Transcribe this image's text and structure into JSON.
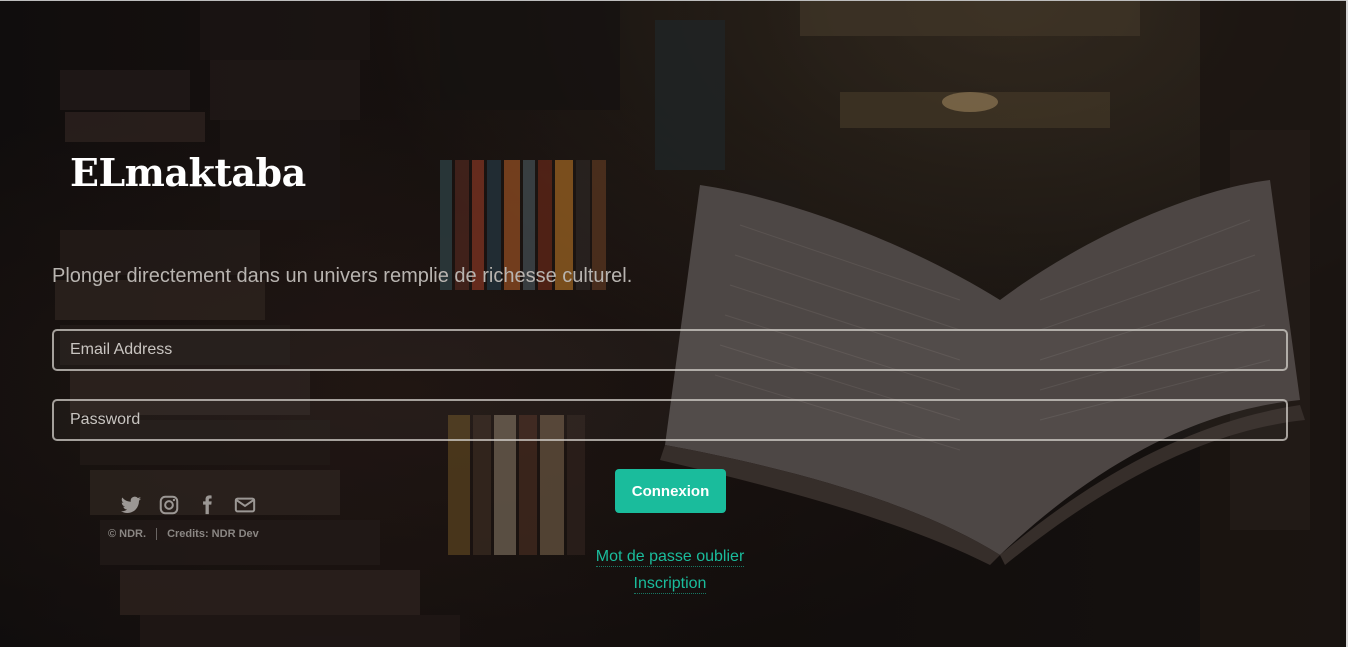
{
  "brand": {
    "title": "ELmaktaba"
  },
  "hero": {
    "tagline": "Plonger directement dans un univers remplie de richesse culturel."
  },
  "form": {
    "email_placeholder": "Email Address",
    "password_placeholder": "Password",
    "submit_label": "Connexion"
  },
  "links": {
    "forgot_password": "Mot de passe oublier",
    "register": "Inscription"
  },
  "footer": {
    "social_icons": [
      "twitter-icon",
      "instagram-icon",
      "facebook-icon",
      "envelope-icon"
    ],
    "copyright": "© NDR.",
    "credits": "Credits: NDR Dev"
  },
  "colors": {
    "accent": "#1abc9c",
    "text_light": "#ffffff",
    "text_muted": "#b8b4b0"
  }
}
